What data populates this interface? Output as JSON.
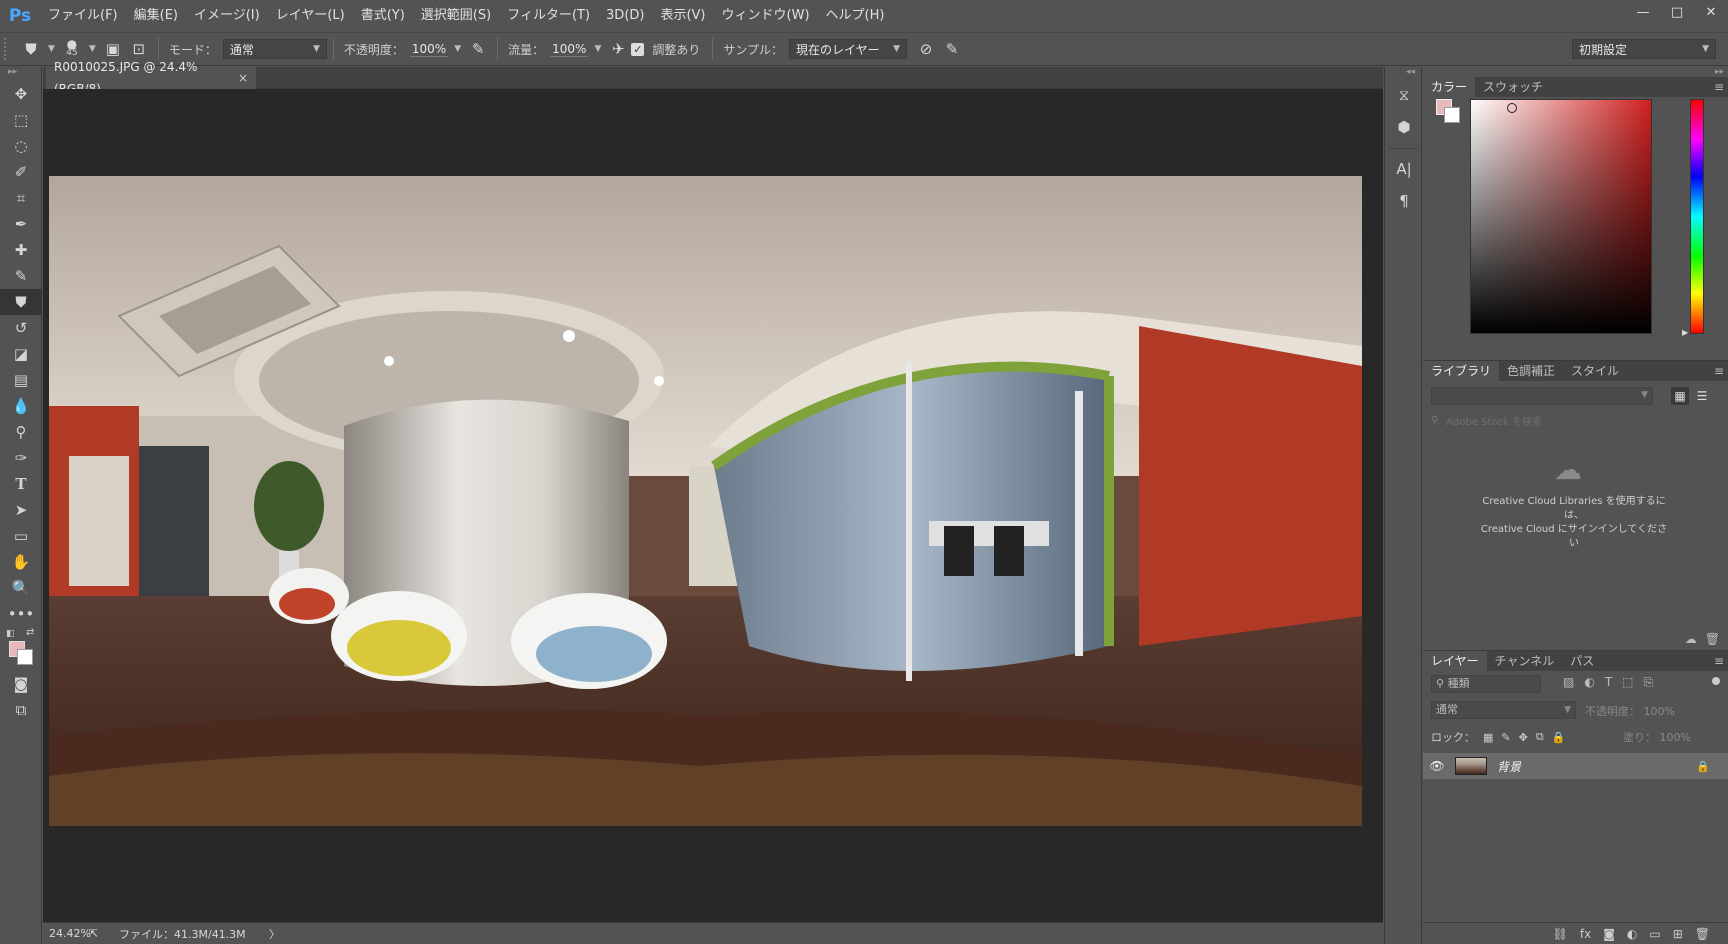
{
  "app": {
    "logo": "Ps"
  },
  "menu": [
    "ファイル(F)",
    "編集(E)",
    "イメージ(I)",
    "レイヤー(L)",
    "書式(Y)",
    "選択範囲(S)",
    "フィルター(T)",
    "3D(D)",
    "表示(V)",
    "ウィンドウ(W)",
    "ヘルプ(H)"
  ],
  "window_controls": {
    "minimize": "—",
    "maximize": "□",
    "close": "✕"
  },
  "options_bar": {
    "brush_size": "45",
    "mode_label": "モード：",
    "mode_value": "通常",
    "opacity_label": "不透明度：",
    "opacity_value": "100%",
    "flow_label": "流量：",
    "flow_value": "100%",
    "aligned_label": "調整あり",
    "aligned_checked": true,
    "sample_label": "サンプル：",
    "sample_value": "現在のレイヤー",
    "workspace_value": "初期設定"
  },
  "document": {
    "tab_title": "R0010025.JPG @ 24.4% (RGB/8)",
    "tab_close": "×"
  },
  "status_bar": {
    "zoom": "24.42%",
    "file_info": "ファイル：41.3M/41.3M",
    "arrow": "〉"
  },
  "color_panel": {
    "tabs": [
      "カラー",
      "スウォッチ"
    ],
    "foreground": "#e9b9b9",
    "background": "#ffffff",
    "hue_color": "#d02020"
  },
  "library_panel": {
    "tabs": [
      "ライブラリ",
      "色調補正",
      "スタイル"
    ],
    "search_placeholder": "Adobe Stock を検索",
    "message_line1": "Creative Cloud Libraries を使用するに",
    "message_line2": "は、",
    "message_line3": "Creative Cloud にサインインしてくださ",
    "message_line4": "い"
  },
  "layers_panel": {
    "tabs": [
      "レイヤー",
      "チャンネル",
      "パス"
    ],
    "filter_value": "種類",
    "blend_mode": "通常",
    "opacity_label": "不透明度：",
    "opacity_value": "100%",
    "lock_label": "ロック：",
    "fill_label": "塗り：",
    "fill_value": "100%",
    "layers": [
      {
        "name": "背景",
        "visible": true,
        "locked": true
      }
    ]
  }
}
